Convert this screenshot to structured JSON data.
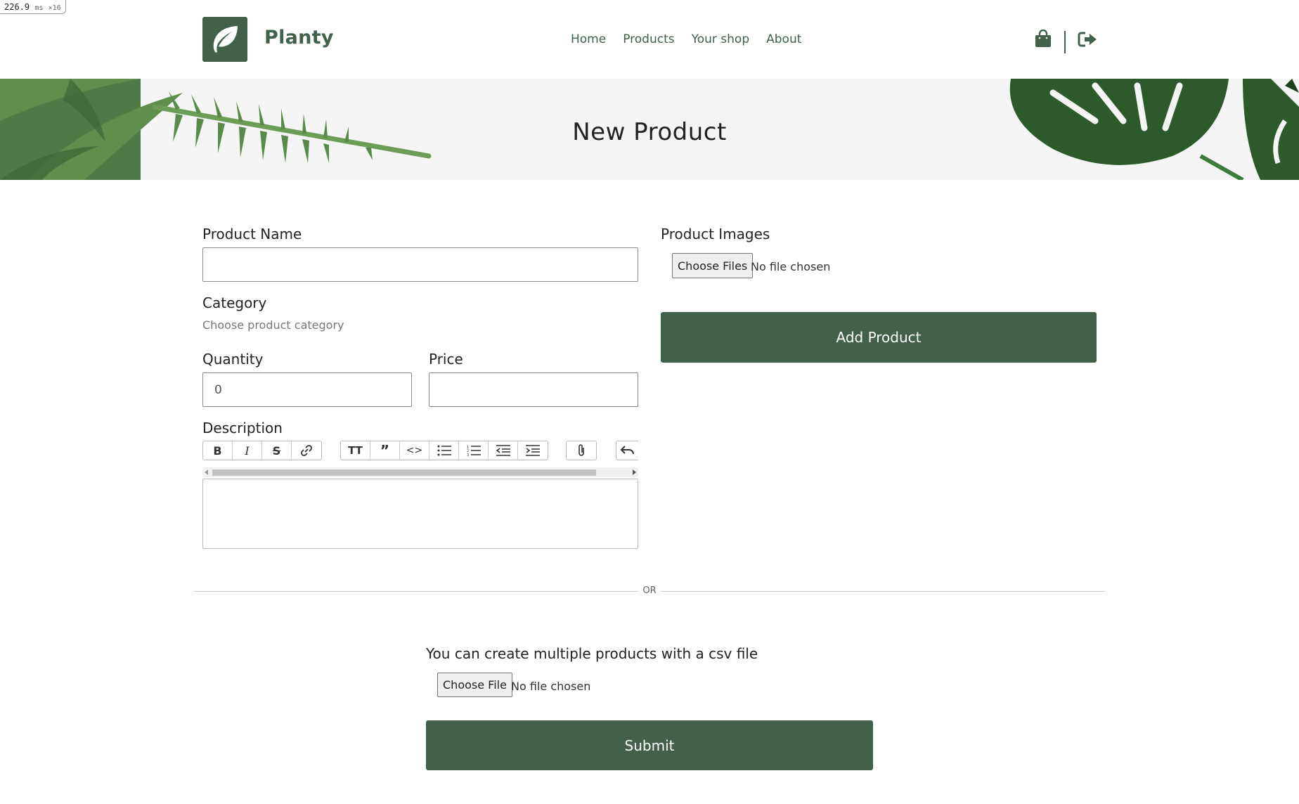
{
  "perf": {
    "value": "226.9",
    "unit": "ms",
    "count": "×16"
  },
  "header": {
    "brand": "Planty",
    "nav": [
      "Home",
      "Products",
      "Your shop",
      "About"
    ]
  },
  "banner": {
    "title": "New Product"
  },
  "form": {
    "product_name_label": "Product Name",
    "product_name_value": "",
    "category_label": "Category",
    "category_placeholder": "Choose product category",
    "quantity_label": "Quantity",
    "quantity_value": "0",
    "price_label": "Price",
    "price_value": "",
    "description_label": "Description",
    "images_label": "Product Images",
    "images_button": "Choose Files",
    "images_status": "No file chosen",
    "add_button": "Add Product"
  },
  "separator": {
    "text": "OR"
  },
  "csv": {
    "label": "You can create multiple products with a csv file",
    "button": "Choose File",
    "status": "No file chosen",
    "submit": "Submit"
  },
  "toolbar": {
    "groups": [
      [
        "bold-icon",
        "italic-icon",
        "strikethrough-icon",
        "link-icon"
      ],
      [
        "heading-icon",
        "quote-icon",
        "code-icon",
        "bullet-list-icon",
        "numbered-list-icon",
        "decrease-indent-icon",
        "increase-indent-icon"
      ],
      [
        "attach-icon"
      ],
      [
        "undo-icon"
      ]
    ]
  },
  "colors": {
    "accent": "#41614a",
    "banner_bg": "#f5f5f5"
  }
}
